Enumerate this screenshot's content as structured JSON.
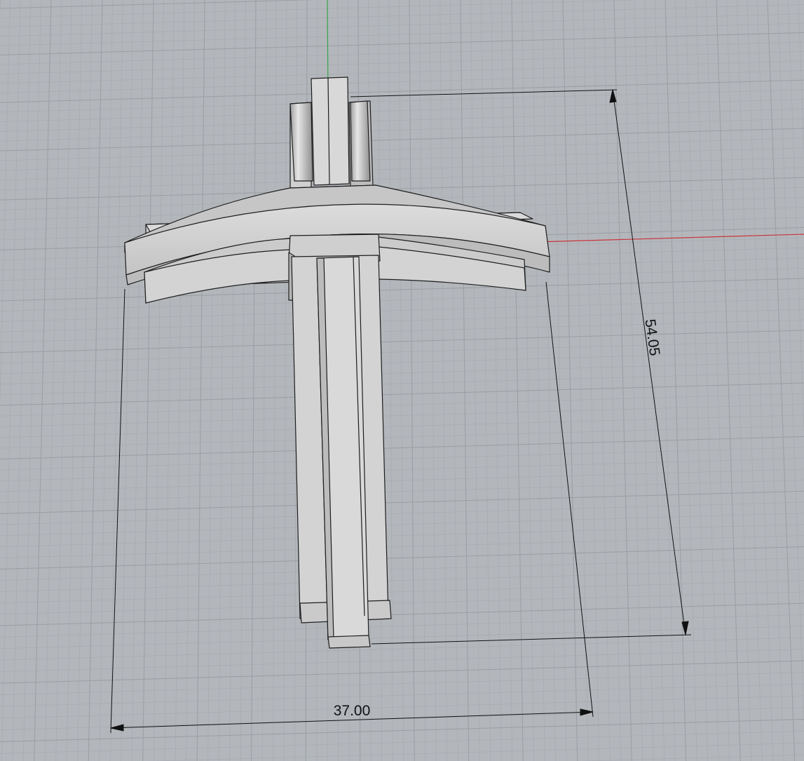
{
  "viewport": {
    "view": "perspective",
    "background_color": "#b3b7bc",
    "grid": true,
    "grid_minor_color": "#a7abb0",
    "grid_major_color": "#9ca0a5",
    "x_axis_color": "#c8353a",
    "y_axis_color": "#3aa34a"
  },
  "model": {
    "shape": "cross",
    "surface_color": "#d2d2d2",
    "shade_color": "#b8b8b8",
    "edge_color": "#1e1e1e"
  },
  "dimensions": {
    "height_label": "54.05",
    "width_label": "37.00"
  }
}
